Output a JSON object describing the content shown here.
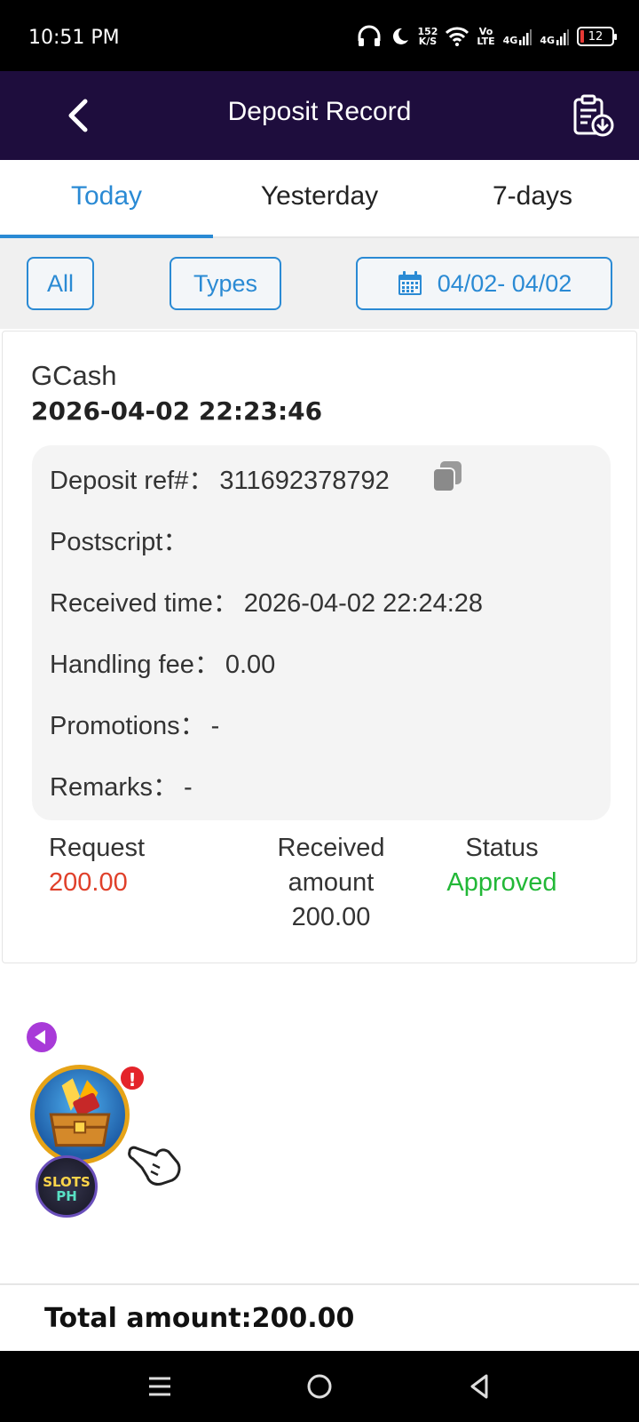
{
  "status_bar": {
    "time": "10:51 PM",
    "net_speed_value": "152",
    "net_speed_unit": "K/S",
    "volte_top": "Vo",
    "volte_bottom": "LTE",
    "sim1": "4G",
    "sim2": "4G",
    "battery": "12",
    "battery_fraction": 0.12
  },
  "header": {
    "title": "Deposit Record",
    "back_icon": "chevron-left-icon",
    "record_icon": "clipboard-download-icon"
  },
  "tabs": [
    {
      "label": "Today",
      "active": true
    },
    {
      "label": "Yesterday",
      "active": false
    },
    {
      "label": "7-days",
      "active": false
    }
  ],
  "filters": {
    "all": "All",
    "types": "Types",
    "date_range": "04/02- 04/02",
    "date_icon": "calendar-icon"
  },
  "record": {
    "method": "GCash",
    "datetime": "2026-04-02 22:23:46",
    "deposit_ref_label": "Deposit ref#：",
    "deposit_ref_value": "311692378792",
    "postscript_label": "Postscript：",
    "postscript_value": "",
    "received_time_label": "Received time：",
    "received_time_value": "2026-04-02 22:24:28",
    "handling_fee_label": "Handling fee：",
    "handling_fee_value": "0.00",
    "promotions_label": "Promotions：",
    "promotions_value": "-",
    "remarks_label": "Remarks：",
    "remarks_value": "-",
    "request_label": "Request",
    "request_value": "200.00",
    "received_amount_label_1": "Received",
    "received_amount_label_2": "amount",
    "received_amount_value": "200.00",
    "status_label": "Status",
    "status_value": "Approved"
  },
  "widget": {
    "alert": "!",
    "logo_top": "SLOTS",
    "logo_bottom": "PH"
  },
  "total": {
    "text": "Total amount:200.00"
  },
  "colors": {
    "header_bg": "#1e0d3d",
    "accent_blue": "#2a8ad4",
    "request_red": "#e0402a",
    "approved_green": "#22b837"
  }
}
